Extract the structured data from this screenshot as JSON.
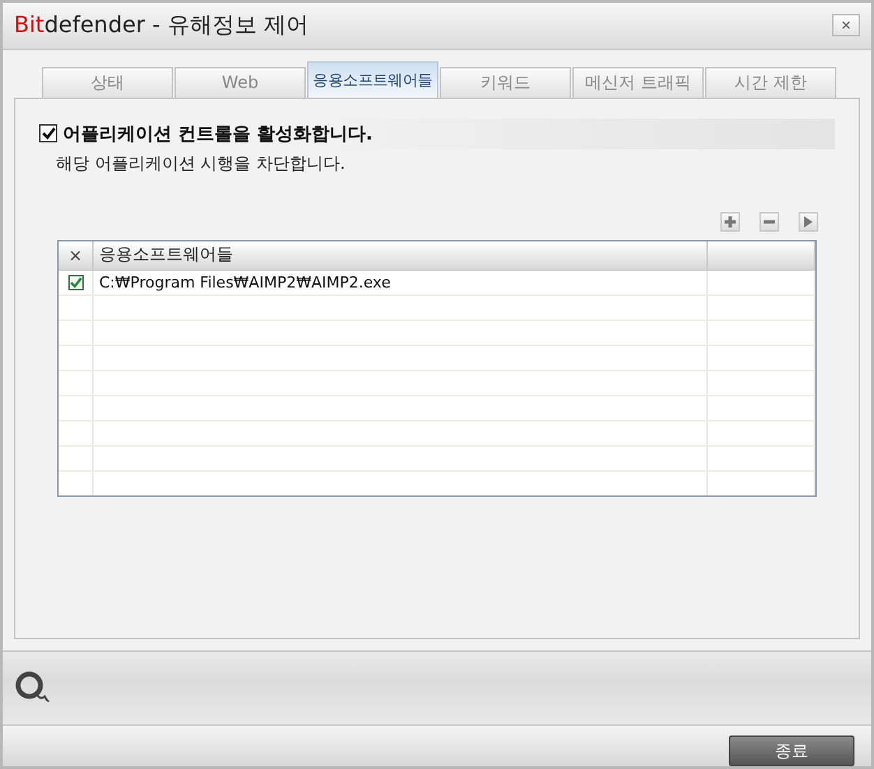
{
  "window": {
    "title_parts": [
      {
        "text": "Bit",
        "color": "#cc1111"
      },
      {
        "text": "defender - 유해정보 제어",
        "color": "#222222"
      }
    ],
    "close": "×"
  },
  "tabs": [
    {
      "label": "상태",
      "selected": false
    },
    {
      "label": "Web",
      "selected": false
    },
    {
      "label": "응용소프트웨어들",
      "selected": true
    },
    {
      "label": "키워드",
      "selected": false
    },
    {
      "label": "메신저 트래픽",
      "selected": false
    },
    {
      "label": "시간 제한",
      "selected": false
    }
  ],
  "enable": {
    "label": "어플리케이션 컨트롤을 활성화합니다.",
    "checked": true,
    "description": "해당 어플리케이션 시행을 차단합니다."
  },
  "table": {
    "columns": [
      "×",
      "응용소프트웨어들"
    ],
    "rows": [
      {
        "checked": true,
        "path": "C:₩Program Files₩AIMP2₩AIMP2.exe"
      }
    ]
  },
  "buttons": [
    {
      "label": "종료"
    }
  ]
}
